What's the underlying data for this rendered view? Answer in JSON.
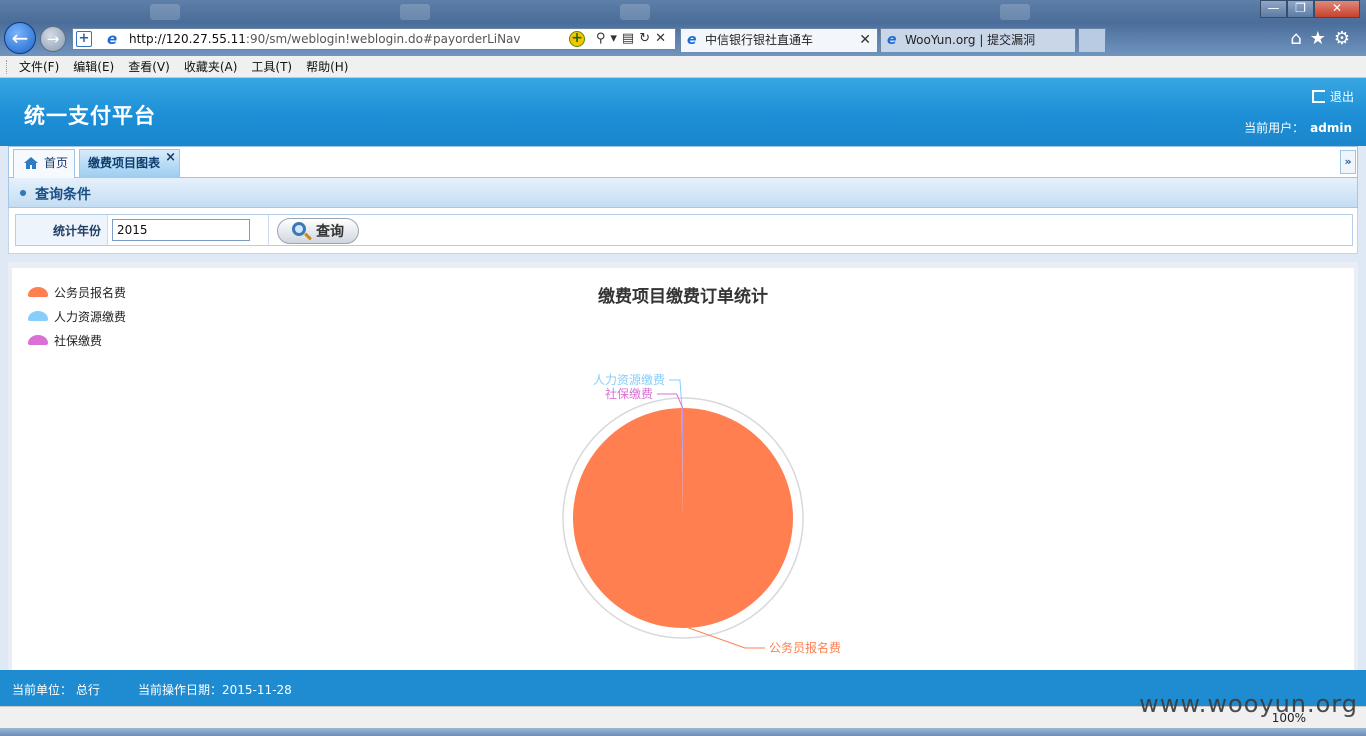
{
  "browser": {
    "address": {
      "host": "http://120.27.55.11",
      "path": ":90/sm/weblogin!weblogin.do#payorderLiNav"
    },
    "tabs": [
      {
        "label": "中信银行银社直通车"
      },
      {
        "label": "WooYun.org | 提交漏洞"
      }
    ],
    "menu": [
      "文件(F)",
      "编辑(E)",
      "查看(V)",
      "收藏夹(A)",
      "工具(T)",
      "帮助(H)"
    ],
    "zoom": "100%"
  },
  "app": {
    "title": "统一支付平台",
    "logout_label": "退出",
    "current_user_label": "当前用户：",
    "current_user": "admin"
  },
  "page_tabs": {
    "home": "首页",
    "active": "缴费项目图表"
  },
  "query": {
    "section_title": "查询条件",
    "year_label": "统计年份",
    "year_value": "2015",
    "search_button": "查询"
  },
  "chart_data": {
    "type": "pie",
    "title": "缴费项目缴费订单统计",
    "legend_position": "top-left",
    "slices": [
      {
        "name": "公务员报名费",
        "value": 99.8,
        "color": "#ff7f50"
      },
      {
        "name": "人力资源缴费",
        "value": 0.1,
        "color": "#87cefa"
      },
      {
        "name": "社保缴费",
        "value": 0.1,
        "color": "#da70d6"
      }
    ]
  },
  "footer": {
    "unit": "当前单位：  总行",
    "date": "当前操作日期：2015-11-28"
  },
  "watermark": "www.wooyun.org"
}
